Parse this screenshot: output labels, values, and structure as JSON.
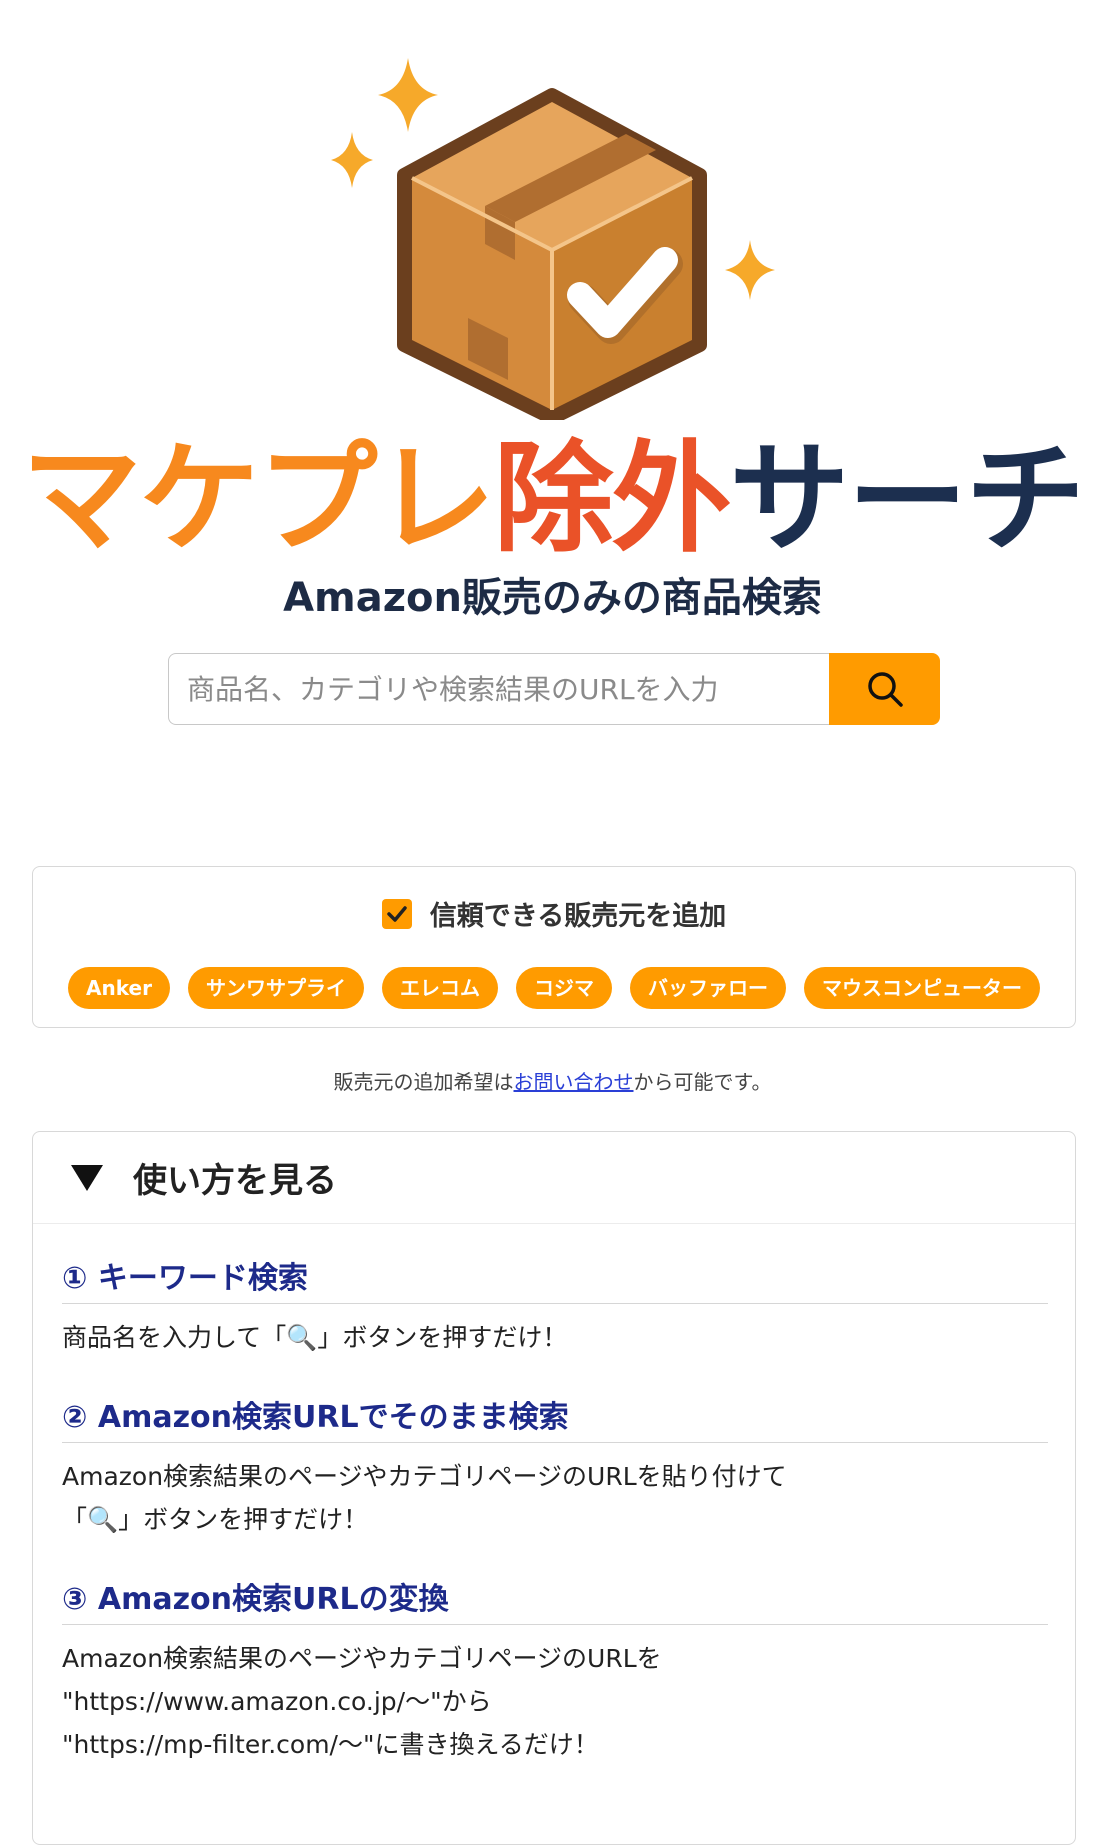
{
  "title": {
    "part1": "マケプレ",
    "part2": "除外",
    "part3": "サーチ"
  },
  "subtitle": "Amazon販売のみの商品検索",
  "search": {
    "placeholder": "商品名、カテゴリや検索結果のURLを入力",
    "value": "",
    "button_icon": "search-icon"
  },
  "seller_filter": {
    "checkbox_checked": true,
    "checkbox_label": "信頼できる販売元を追加",
    "tags": [
      "Anker",
      "サンワサプライ",
      "エレコム",
      "コジマ",
      "バッファロー",
      "マウスコンピューター"
    ],
    "note_before": "販売元の追加希望は",
    "note_link": "お問い合わせ",
    "note_after": "から可能です。"
  },
  "howto": {
    "summary_label": "使い方を見る",
    "steps": [
      {
        "heading": "① キーワード検索",
        "lines": [
          "商品名を入力して「🔍」ボタンを押すだけ！"
        ]
      },
      {
        "heading": "② Amazon検索URLでそのまま検索",
        "lines": [
          "Amazon検索結果のページやカテゴリページのURLを貼り付けて",
          "「🔍」ボタンを押すだけ！"
        ]
      },
      {
        "heading": "③ Amazon検索URLの変換",
        "lines": [
          "Amazon検索結果のページやカテゴリページのURLを",
          "\"https://www.amazon.co.jp/～\"から",
          "\"https://mp-filter.com/～\"に書き換えるだけ！"
        ]
      }
    ]
  },
  "colors": {
    "orange": "#ff9b00",
    "title_orange": "#f7891e",
    "title_red": "#ea5228",
    "title_navy": "#1c2f4f",
    "heading_blue": "#1d2a8a"
  },
  "logo_icon": "package-check-icon"
}
